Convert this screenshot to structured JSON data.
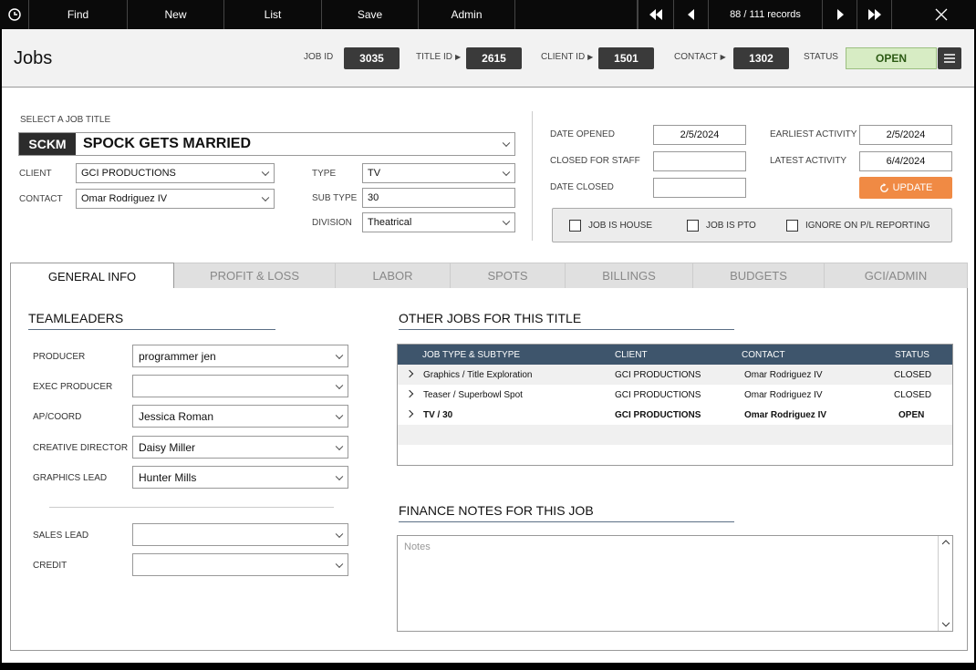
{
  "toolbar": {
    "find": "Find",
    "new": "New",
    "list": "List",
    "save": "Save",
    "admin": "Admin",
    "records": "88 / 111 records"
  },
  "header": {
    "title": "Jobs",
    "job_id_label": "JOB ID",
    "job_id": "3035",
    "title_id_label": "TITLE ID",
    "title_id": "2615",
    "client_id_label": "CLIENT ID",
    "client_id": "1501",
    "contact_label": "CONTACT",
    "contact_id": "1302",
    "status_label": "STATUS",
    "status": "OPEN"
  },
  "job": {
    "select_label": "SELECT A JOB TITLE",
    "code": "SCKM",
    "title": "SPOCK GETS MARRIED",
    "client_label": "CLIENT",
    "client": "GCI PRODUCTIONS",
    "contact_label": "CONTACT",
    "contact": "Omar Rodriguez IV",
    "type_label": "TYPE",
    "type": "TV",
    "subtype_label": "SUB TYPE",
    "subtype": "30",
    "division_label": "DIVISION",
    "division": "Theatrical"
  },
  "dates": {
    "opened_label": "DATE OPENED",
    "opened": "2/5/2024",
    "closed_staff_label": "CLOSED FOR STAFF",
    "closed_staff": "",
    "closed_label": "DATE CLOSED",
    "closed": "",
    "earliest_label": "EARLIEST ACTIVITY",
    "earliest": "2/5/2024",
    "latest_label": "LATEST ACTIVITY",
    "latest": "6/4/2024",
    "update": "UPDATE"
  },
  "checks": {
    "house": "JOB IS HOUSE",
    "pto": "JOB IS PTO",
    "ignore": "IGNORE ON P/L REPORTING"
  },
  "tabs": [
    "GENERAL INFO",
    "PROFIT & LOSS",
    "LABOR",
    "SPOTS",
    "BILLINGS",
    "BUDGETS",
    "GCI/ADMIN"
  ],
  "teamleaders": {
    "title": "TEAMLEADERS",
    "producer_label": "PRODUCER",
    "producer": "programmer jen",
    "exec_label": "EXEC PRODUCER",
    "exec": "",
    "ap_label": "AP/COORD",
    "ap": "Jessica Roman",
    "creative_label": "CREATIVE DIRECTOR",
    "creative": "Daisy Miller",
    "graphics_label": "GRAPHICS LEAD",
    "graphics": "Hunter Mills",
    "sales_label": "SALES LEAD",
    "sales": "",
    "credit_label": "CREDIT",
    "credit": ""
  },
  "other_jobs": {
    "title": "OTHER JOBS FOR THIS TITLE",
    "headers": {
      "type": "JOB TYPE & SUBTYPE",
      "client": "CLIENT",
      "contact": "CONTACT",
      "status": "STATUS"
    },
    "rows": [
      {
        "type": "Graphics / Title Exploration",
        "client": "GCI PRODUCTIONS",
        "contact": "Omar Rodriguez IV",
        "status": "CLOSED"
      },
      {
        "type": "Teaser  / Superbowl Spot",
        "client": "GCI PRODUCTIONS",
        "contact": "Omar Rodriguez IV",
        "status": "CLOSED"
      },
      {
        "type": "TV / 30",
        "client": "GCI PRODUCTIONS",
        "contact": "Omar Rodriguez IV",
        "status": "OPEN"
      }
    ]
  },
  "finance": {
    "title": "FINANCE NOTES FOR THIS JOB",
    "placeholder": "Notes"
  }
}
